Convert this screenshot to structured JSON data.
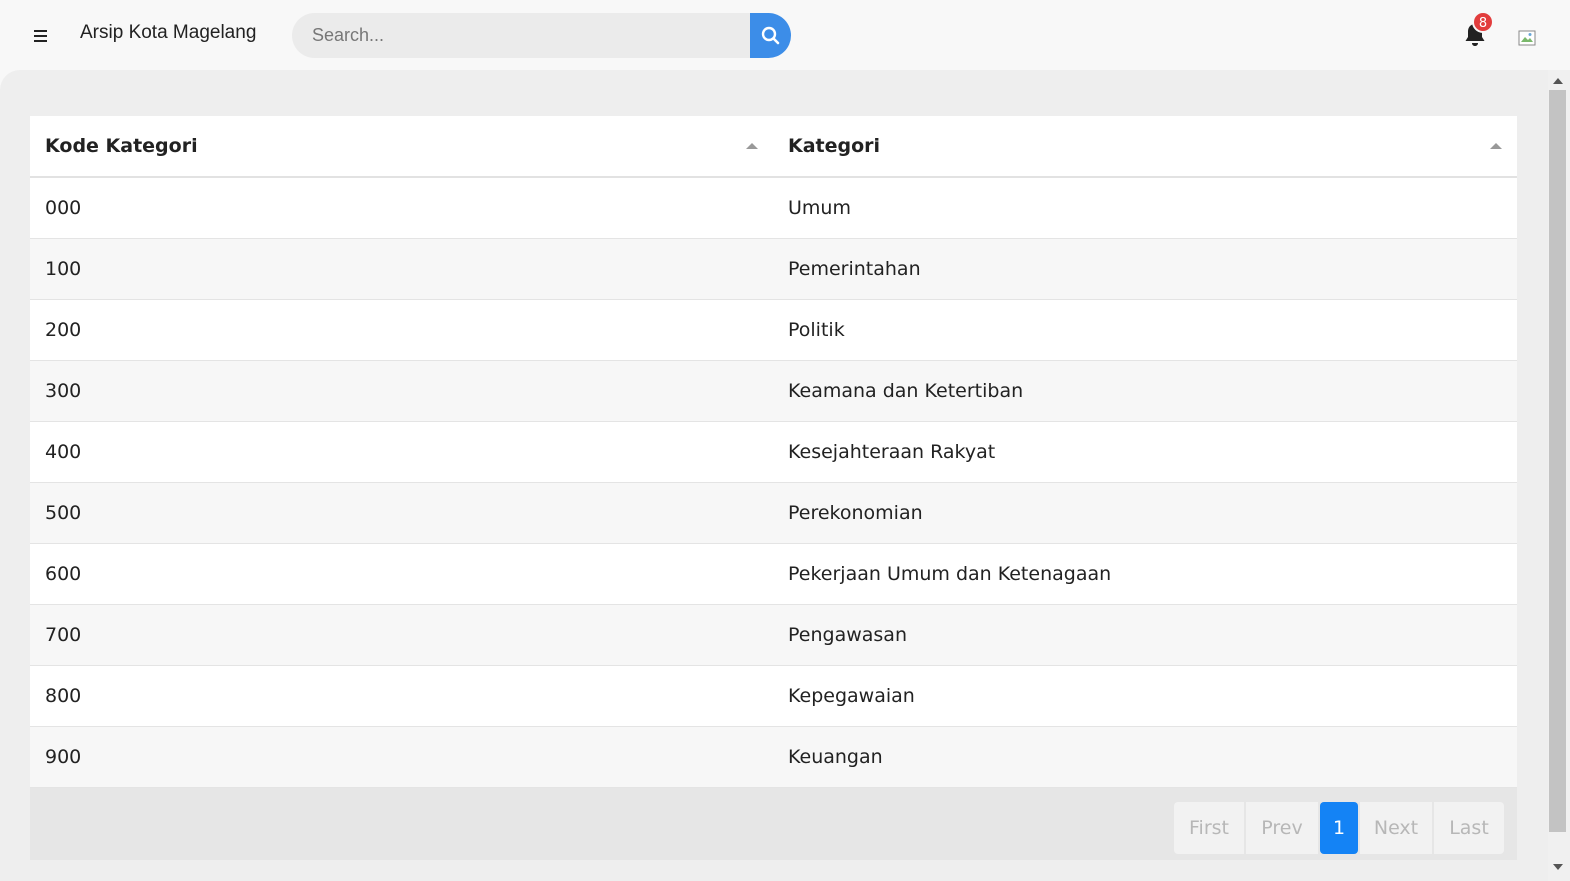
{
  "header": {
    "menu_icon": "hamburger-icon",
    "title": "Arsip Kota Magelang",
    "search_placeholder": "Search...",
    "search_icon": "search-icon",
    "notification_icon": "bell-icon",
    "notification_count": "8",
    "avatar_icon": "broken-image-icon"
  },
  "table": {
    "columns": [
      "Kode Kategori",
      "Kategori"
    ],
    "rows": [
      {
        "kode": "000",
        "kategori": "Umum"
      },
      {
        "kode": "100",
        "kategori": "Pemerintahan"
      },
      {
        "kode": "200",
        "kategori": "Politik"
      },
      {
        "kode": "300",
        "kategori": "Keamana dan Ketertiban"
      },
      {
        "kode": "400",
        "kategori": "Kesejahteraan Rakyat"
      },
      {
        "kode": "500",
        "kategori": "Perekonomian"
      },
      {
        "kode": "600",
        "kategori": "Pekerjaan Umum dan Ketenagaan"
      },
      {
        "kode": "700",
        "kategori": "Pengawasan"
      },
      {
        "kode": "800",
        "kategori": "Kepegawaian"
      },
      {
        "kode": "900",
        "kategori": "Keuangan"
      }
    ]
  },
  "pagination": {
    "first": "First",
    "prev": "Prev",
    "current": "1",
    "next": "Next",
    "last": "Last"
  },
  "colors": {
    "accent": "#1483f5",
    "search_button": "#3c8de8",
    "badge": "#e23d3d"
  }
}
